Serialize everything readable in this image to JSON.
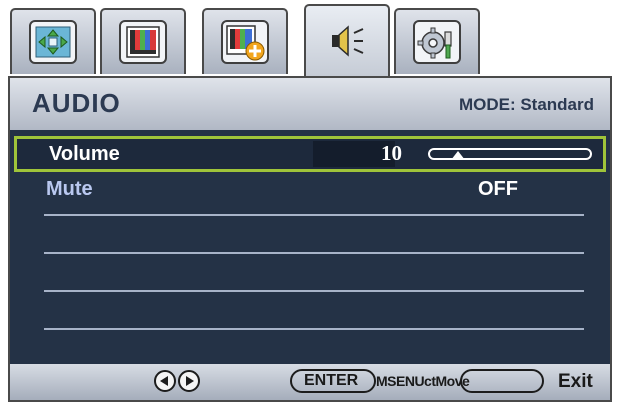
{
  "tabs": [
    {
      "name": "tab-display",
      "icon": "display-adjust-icon",
      "active": false
    },
    {
      "name": "tab-picture",
      "icon": "picture-icon",
      "active": false
    },
    {
      "name": "tab-picture-advanced",
      "icon": "picture-advanced-icon",
      "active": false
    },
    {
      "name": "tab-audio",
      "icon": "speaker-icon",
      "active": true
    },
    {
      "name": "tab-system",
      "icon": "system-settings-icon",
      "active": false
    }
  ],
  "header": {
    "title": "AUDIO",
    "mode": "MODE: Standard"
  },
  "rows": {
    "volume": {
      "label": "Volume",
      "value": "10",
      "level": 0.1
    },
    "mute": {
      "label": "Mute",
      "value": "OFF"
    }
  },
  "footer": {
    "enter_label": "ENTER",
    "overlap_text": "MSENUctMove",
    "exit_label": "Exit"
  },
  "colors": {
    "panel": "#243246",
    "selection": "#9fc43a",
    "header": "#c9ced8"
  }
}
